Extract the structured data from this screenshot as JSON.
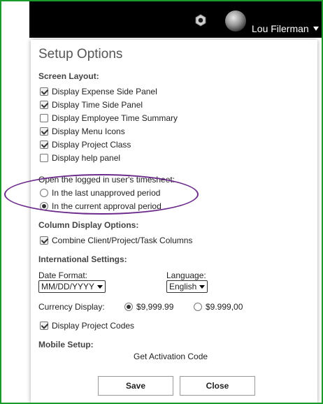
{
  "header": {
    "username": "Lou Filerman",
    "icons": [
      "gear-icon",
      "avatar",
      "chevron-down-icon"
    ]
  },
  "panel": {
    "title": "Setup Options",
    "screen_layout": {
      "heading": "Screen Layout:",
      "options": [
        {
          "label": "Display Expense Side Panel",
          "checked": true
        },
        {
          "label": "Display Time Side Panel",
          "checked": true
        },
        {
          "label": "Display Employee Time Summary",
          "checked": false
        },
        {
          "label": "Display Menu Icons",
          "checked": true
        },
        {
          "label": "Display Project Class",
          "checked": true
        },
        {
          "label": "Display help panel",
          "checked": false
        }
      ]
    },
    "timesheet_period": {
      "question": "Open the logged in user's timesheet:",
      "options": [
        {
          "label": "In the last unapproved period",
          "selected": false
        },
        {
          "label": "In the current approval period",
          "selected": true
        }
      ],
      "highlight_color": "#6b2a8a"
    },
    "column_display": {
      "heading": "Column Display Options:",
      "option": {
        "label": "Combine Client/Project/Task Columns",
        "checked": true
      }
    },
    "international": {
      "heading": "International Settings:",
      "date_format_label": "Date Format:",
      "date_format_value": "MM/DD/YYYY",
      "language_label": "Language:",
      "language_value": "English",
      "currency_label": "Currency Display:",
      "currency_options": [
        {
          "label": "$9,999.99",
          "selected": true
        },
        {
          "label": "$9.999,00",
          "selected": false
        }
      ],
      "project_codes": {
        "label": "Display Project Codes",
        "checked": true
      }
    },
    "mobile": {
      "heading": "Mobile Setup:",
      "activation_link": "Get Activation Code"
    },
    "buttons": {
      "save": "Save",
      "close": "Close"
    }
  },
  "colors": {
    "frame_border": "#1a9a2a",
    "topbar": "#000000",
    "title_text": "#555555"
  }
}
